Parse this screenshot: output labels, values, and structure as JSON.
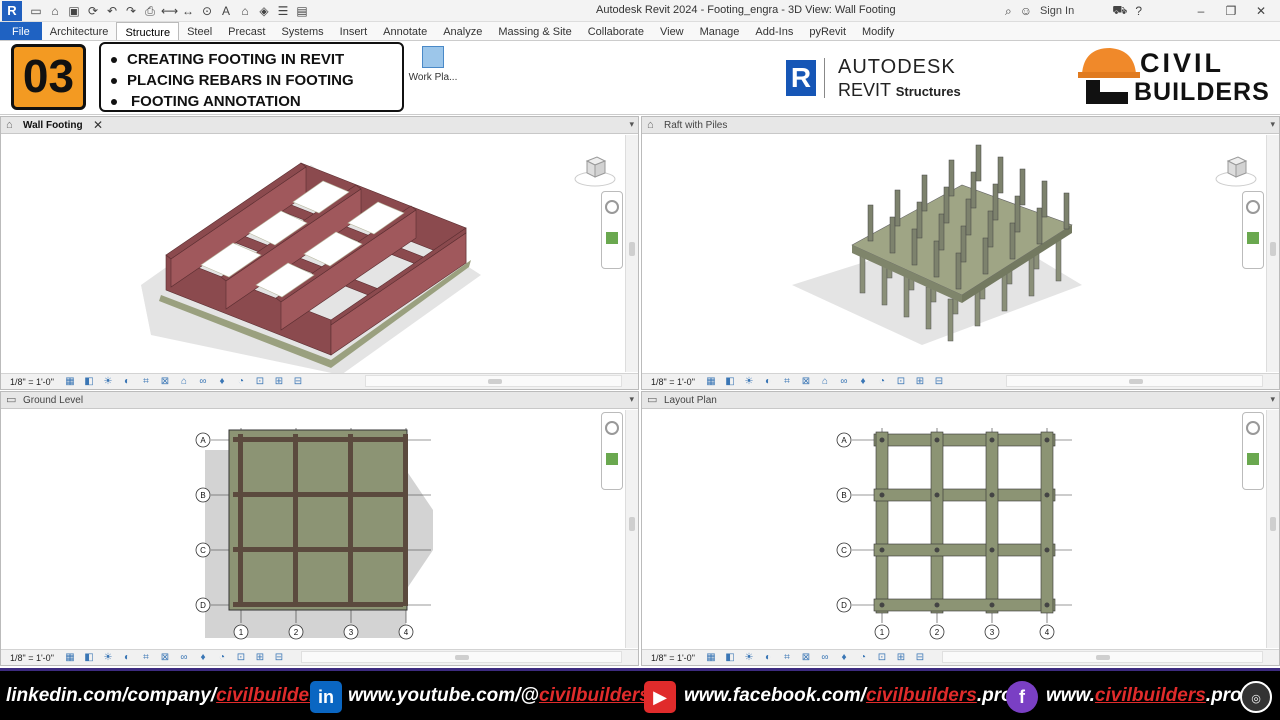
{
  "window": {
    "app_icon": "R",
    "title": "Autodesk Revit 2024 - Footing_engra - 3D View: Wall Footing",
    "sign_in": "Sign In"
  },
  "ribbon": {
    "tabs": [
      {
        "label": "File",
        "state": "file"
      },
      {
        "label": "Architecture",
        "state": ""
      },
      {
        "label": "Structure",
        "state": "active"
      },
      {
        "label": "Steel",
        "state": ""
      },
      {
        "label": "Precast",
        "state": ""
      },
      {
        "label": "Systems",
        "state": ""
      },
      {
        "label": "Insert",
        "state": ""
      },
      {
        "label": "Annotate",
        "state": ""
      },
      {
        "label": "Analyze",
        "state": ""
      },
      {
        "label": "Massing & Site",
        "state": ""
      },
      {
        "label": "Collaborate",
        "state": ""
      },
      {
        "label": "View",
        "state": ""
      },
      {
        "label": "Manage",
        "state": ""
      },
      {
        "label": "Add-Ins",
        "state": ""
      },
      {
        "label": "pyRevit",
        "state": ""
      },
      {
        "label": "Modify",
        "state": ""
      }
    ],
    "work_plane_label": "Work Pla..."
  },
  "overlay": {
    "episode_number": "03",
    "topics": [
      "CREATING FOOTING IN REVIT",
      "PLACING REBARS IN FOOTING",
      "FOOTING ANNOTATION"
    ],
    "revit_logo": {
      "autodesk": "AUTODESK",
      "revit": "REVIT",
      "product": "Structures"
    },
    "brand": {
      "line1": "CIVIL",
      "line2": "BUILDERS"
    }
  },
  "views": {
    "wall_footing": {
      "title": "Wall Footing",
      "scale": "1/8\" = 1'-0\""
    },
    "raft_with_piles": {
      "title": "Raft with Piles",
      "scale": "1/8\" = 1'-0\""
    },
    "ground_level": {
      "title": "Ground Level",
      "scale": "1/8\" = 1'-0\""
    },
    "layout_plan": {
      "title": "Layout Plan",
      "scale": "1/8\" = 1'-0\""
    }
  },
  "grid": {
    "rows": [
      "A",
      "B",
      "C",
      "D"
    ],
    "cols": [
      "1",
      "2",
      "3",
      "4"
    ]
  },
  "footer": {
    "linkedin": {
      "pre": "linkedin.com/company/",
      "hl": "civilbuilders",
      "post": ""
    },
    "youtube": {
      "pre": "www.youtube.com/@",
      "hl": "civilbuilders",
      "post": ""
    },
    "facebook": {
      "pre": "www.facebook.com/",
      "hl": "civilbuilders",
      "post": ".pro/"
    },
    "website": {
      "pre": "www.",
      "hl": "civilbuilders",
      "post": ".pro"
    }
  },
  "colors": {
    "file_tab": "#1f62c2",
    "episode_badge": "#f39a22",
    "brick": "#8b4a4e",
    "concrete": "#8c9474",
    "footer_bg": "#000000",
    "footer_highlight": "#e02b2b"
  }
}
